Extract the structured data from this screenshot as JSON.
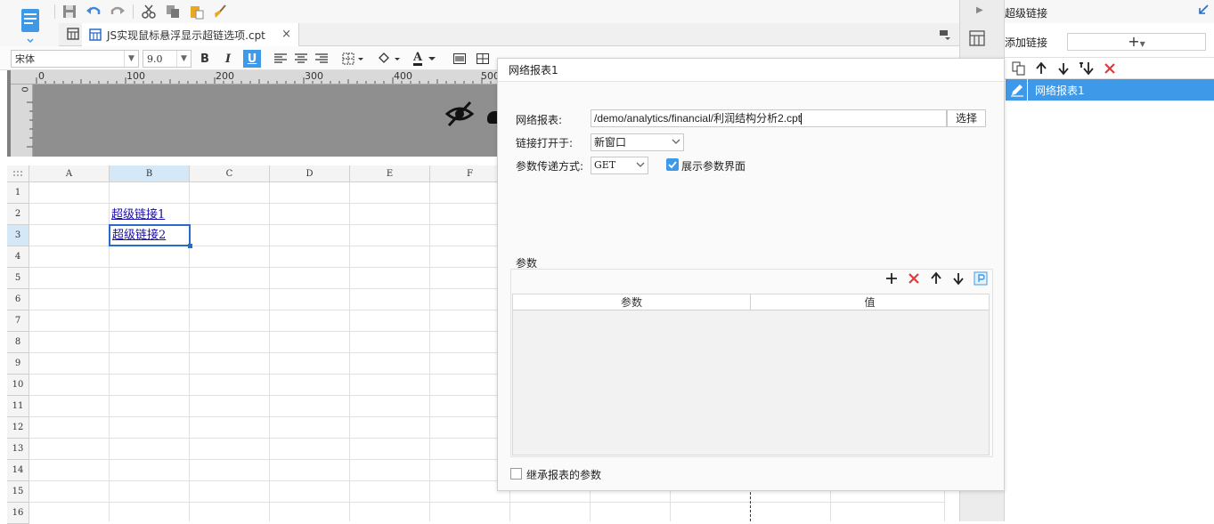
{
  "toolbar": {
    "icons": [
      "logo-icon",
      "save-icon",
      "undo-icon",
      "redo-icon",
      "cut-icon",
      "copy-icon",
      "paste-icon",
      "format-painter-icon"
    ]
  },
  "tab": {
    "title": "JS实现鼠标悬浮显示超链选项.cpt",
    "close": "×"
  },
  "format": {
    "font": "宋体",
    "size": "9.0",
    "bold": "B",
    "italic": "I",
    "underline": "U",
    "font_color": "A"
  },
  "ruler": {
    "ticks": [
      "0",
      "100",
      "200",
      "300",
      "400",
      "500"
    ],
    "vticks": [
      "0"
    ]
  },
  "sheet": {
    "columns": [
      "A",
      "B",
      "C",
      "D",
      "E",
      "F"
    ],
    "rows": [
      "1",
      "2",
      "3",
      "4",
      "5",
      "6",
      "7",
      "8",
      "9",
      "10",
      "11",
      "12",
      "13",
      "14",
      "15",
      "16"
    ],
    "cells": {
      "B2": "超级链接1",
      "B3": "超级链接2"
    }
  },
  "right_panel": {
    "title": "超级链接",
    "add_label": "添加链接",
    "add_button": "+",
    "items": [
      "网络报表1"
    ]
  },
  "dialog": {
    "title": "网络报表1",
    "report_label": "网络报表:",
    "report_path": "/demo/analytics/financial/利润结构分析2.cpt",
    "select_button": "选择",
    "open_in_label": "链接打开于:",
    "open_in_value": "新窗口",
    "param_method_label": "参数传递方式:",
    "param_method_value": "GET",
    "show_params_label": "展示参数界面",
    "show_params_checked": true,
    "params_group_label": "参数",
    "params_columns": [
      "参数",
      "值"
    ],
    "inherit_label": "继承报表的参数",
    "inherit_checked": false
  },
  "colors": {
    "accent": "#3e9ae8",
    "link": "#1a0dab",
    "danger": "#e03a3a"
  }
}
